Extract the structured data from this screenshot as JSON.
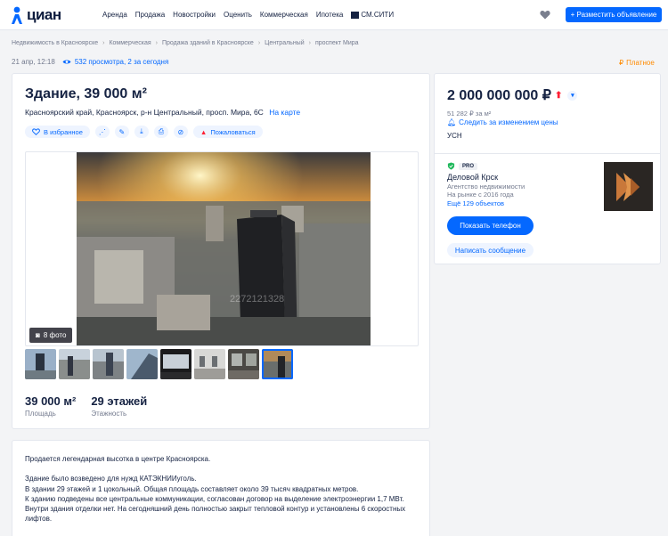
{
  "header": {
    "logo_text": "циан",
    "nav": [
      "Аренда",
      "Продажа",
      "Новостройки",
      "Оценить",
      "Коммерческая",
      "Ипотека",
      "СМ.СИТИ"
    ],
    "post_button": "+ Разместить объявление"
  },
  "breadcrumbs": [
    "Недвижимость в Красноярске",
    "Коммерческая",
    "Продажа зданий в Красноярске",
    "Центральный",
    "проспект Мира"
  ],
  "meta": {
    "date": "21 апр, 12:18",
    "views": "532 просмотра, 2 за сегодня",
    "paid": "Платное"
  },
  "listing": {
    "title": "Здание, 39 000 м²",
    "address": "Красноярский край, Красноярск, р-н Центральный, просп. Мира, 6С",
    "map_link": "На карте",
    "favorite": "В избранное",
    "report": "Пожаловаться",
    "photo_button": "8 фото",
    "watermark": "2272121328"
  },
  "stats": [
    {
      "value": "39 000 м²",
      "label": "Площадь"
    },
    {
      "value": "29 этажей",
      "label": "Этажность"
    }
  ],
  "price": {
    "value": "2 000 000 000 ₽",
    "per_meter": "51 282 ₽ за м²",
    "subscribe": "Следить за изменением цены",
    "tax": "УСН"
  },
  "agent": {
    "badge": "PRO",
    "name": "Деловой Крск",
    "type": "Агентство недвижимости",
    "since": "На рынке с 2016 года",
    "objects": "Ещё 129 объектов",
    "phone_button": "Показать телефон",
    "message_button": "Написать сообщение"
  },
  "description": {
    "p1": "Продается легендарная высотка в центре Красноярска.",
    "p2": "Здание было возведено для нужд КАТЭКНИИуголь.",
    "p3": "В здании 29 этажей и 1 цокольный. Общая площадь составляет около 39 тысяч квадратных метров.",
    "p4": "К зданию подведены все центральные коммуникации, согласован договор на выделение электроэнергии 1,7 МВт.",
    "p5": "Внутри здания отделки нет. На сегодняшний день полностью закрыт тепловой контур и установлены 6 скоростных лифтов."
  },
  "colors": {
    "accent": "#0468ff",
    "text": "#152242",
    "muted": "#737a8e",
    "paid": "#ff8a00",
    "price_up": "#ff1f34"
  }
}
